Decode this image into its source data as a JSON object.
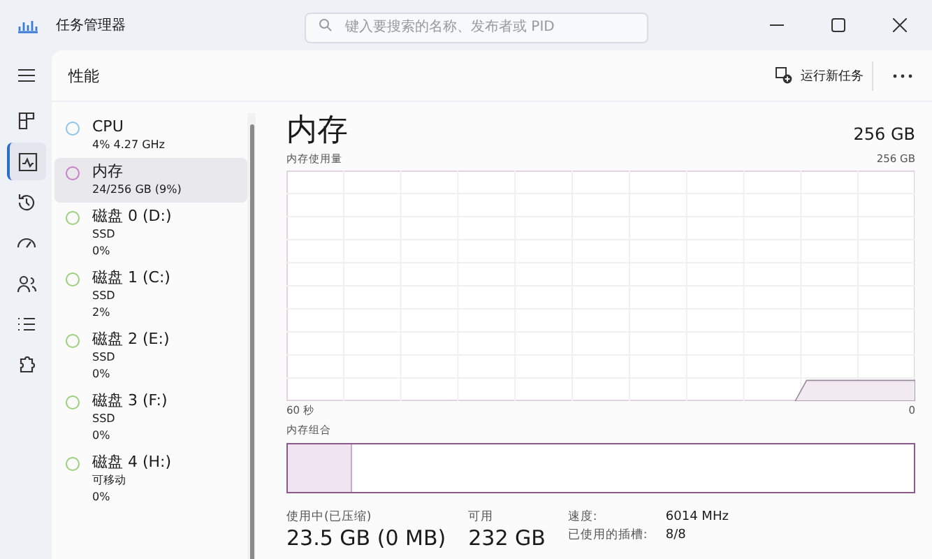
{
  "window": {
    "title": "任务管理器"
  },
  "search": {
    "placeholder": "键入要搜索的名称、发布者或 PID"
  },
  "nav_items": [
    {
      "selected": false
    },
    {
      "selected": false
    },
    {
      "selected": true
    },
    {
      "selected": false
    },
    {
      "selected": false
    },
    {
      "selected": false
    },
    {
      "selected": false
    },
    {
      "selected": false
    }
  ],
  "page_title": "性能",
  "run_task_button": "运行新任务",
  "resources": [
    {
      "name": "CPU",
      "details": [
        "4% 4.27 GHz"
      ],
      "color": "#8cc4e8",
      "selected": false
    },
    {
      "name": "内存",
      "details": [
        "24/256 GB (9%)"
      ],
      "color": "#c77fc7",
      "selected": true
    },
    {
      "name": "磁盘 0 (D:)",
      "details": [
        "SSD",
        "0%"
      ],
      "color": "#9ccf78",
      "selected": false
    },
    {
      "name": "磁盘 1 (C:)",
      "details": [
        "SSD",
        "2%"
      ],
      "color": "#9ccf78",
      "selected": false
    },
    {
      "name": "磁盘 2 (E:)",
      "details": [
        "SSD",
        "0%"
      ],
      "color": "#9ccf78",
      "selected": false
    },
    {
      "name": "磁盘 3 (F:)",
      "details": [
        "SSD",
        "0%"
      ],
      "color": "#9ccf78",
      "selected": false
    },
    {
      "name": "磁盘 4 (H:)",
      "details": [
        "可移动",
        "0%"
      ],
      "color": "#9ccf78",
      "selected": false
    }
  ],
  "detail": {
    "title": "内存",
    "total": "256 GB",
    "graph_label": "内存使用量",
    "graph_max": "256 GB",
    "time_start": "60 秒",
    "time_end": "0",
    "composition_label": "内存组合",
    "composition": {
      "level": 0.1
    },
    "stats": [
      {
        "label": "使用中(已压缩)",
        "value": "23.5 GB (0 MB)"
      },
      {
        "label": "可用",
        "value": "232 GB"
      }
    ],
    "properties": [
      {
        "label": "速度:",
        "value": "6014 MHz"
      },
      {
        "label": "已使用的插槽:",
        "value": "8/8"
      }
    ]
  }
}
